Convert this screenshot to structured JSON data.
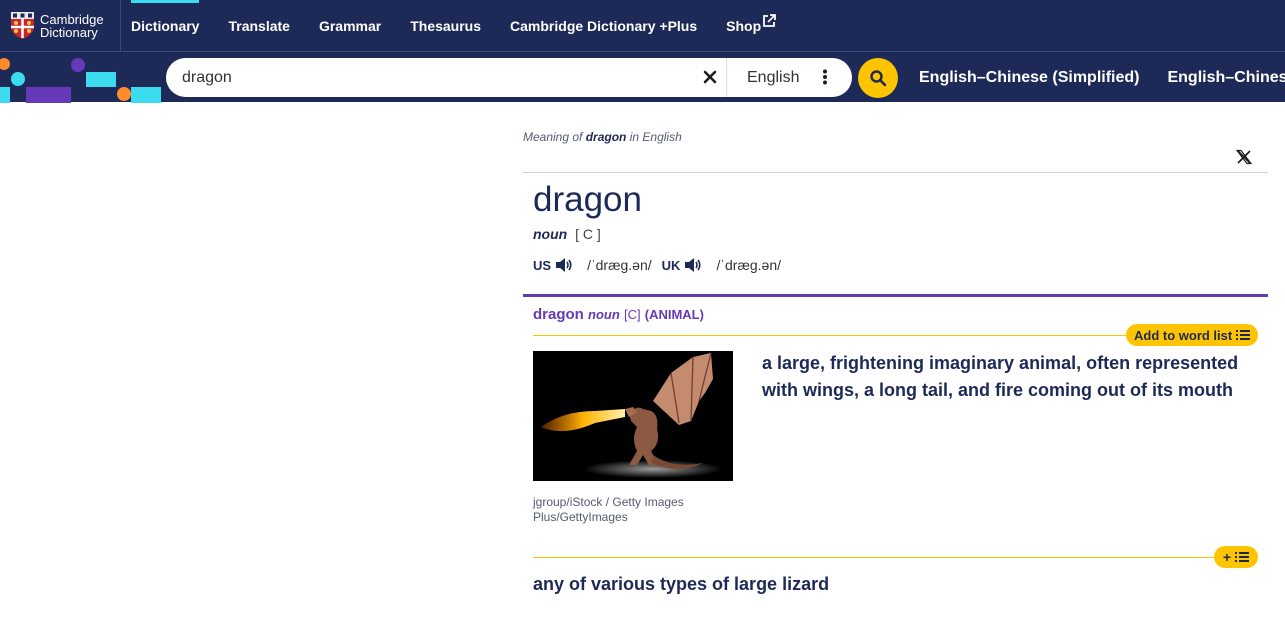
{
  "header": {
    "logo": {
      "line1": "Cambridge",
      "line2": "Dictionary"
    },
    "nav": [
      {
        "label": "Dictionary",
        "active": true
      },
      {
        "label": "Translate"
      },
      {
        "label": "Grammar"
      },
      {
        "label": "Thesaurus"
      },
      {
        "label": "Cambridge Dictionary +Plus"
      },
      {
        "label": "Shop",
        "icon": "external-link-icon"
      }
    ]
  },
  "search": {
    "value": "dragon",
    "language": "English",
    "clear_icon": "close-icon",
    "more_icon": "kebab-menu-icon",
    "submit_icon": "search-icon"
  },
  "dictionary_links": [
    "English–Chinese (Simplified)",
    "English–Chines"
  ],
  "entry": {
    "meaning_prefix": "Meaning of",
    "meaning_word": "dragon",
    "meaning_suffix": "in English",
    "share_icon": "x-twitter-icon",
    "headword": "dragon",
    "pos": "noun",
    "grammar": "[ C ]",
    "pronunciations": [
      {
        "region": "US",
        "ipa": "/ˈdræɡ.ən/"
      },
      {
        "region": "UK",
        "ipa": "/ˈdræɡ.ən/"
      }
    ],
    "sense": {
      "word": "dragon",
      "pos": "noun",
      "grammar": "[C]",
      "guideword": "(ANIMAL)",
      "add_label": "Add to word list",
      "image_credit": "jgroup/iStock / Getty Images Plus/GettyImages",
      "definition": "a large, frightening imaginary animal, often represented with wings, a long tail, and fire coming out of its mouth"
    },
    "sense2": {
      "add_symbol": "+",
      "definition": "any of various types of large lizard"
    }
  },
  "colors": {
    "navy": "#1d2a57",
    "yellow": "#fec400",
    "purple": "#6539b8",
    "cyan": "#3ddbef",
    "orange": "#fe8b2c"
  }
}
